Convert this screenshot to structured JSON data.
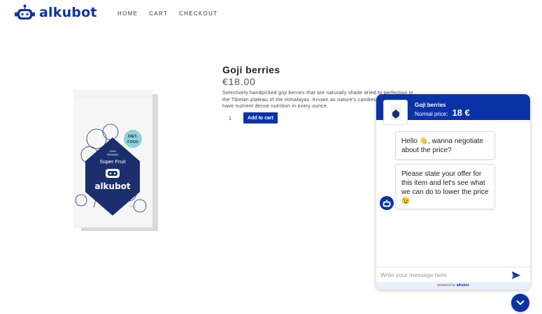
{
  "brand": {
    "name": "alkubot",
    "color": "#0a33a8"
  },
  "nav": {
    "items": [
      "HOME",
      "CART",
      "CHECKOUT"
    ]
  },
  "product": {
    "title": "Goji berries",
    "price": "€18.00",
    "description": "Selectively handpicked goji berries that are naturally shade dried to perfection in the Tibetan plateau of the Himalayas. Known as nature's candies our goji berries have nutrient dense nutrition in every ounce.",
    "quantity": "1",
    "add_to_cart_label": "Add to cart",
    "package": {
      "badge": [
        "DIET-",
        "FOOD"
      ],
      "organic": [
        "100%",
        "ORGANIC"
      ],
      "label": "Super Fruit",
      "brand": "alkubot",
      "weight": "500 g"
    }
  },
  "chat": {
    "product_title": "Goji berries",
    "normal_price_label": "Normal price:",
    "normal_price_value": "18 €",
    "messages": [
      {
        "from": "bot",
        "text": "Hello 👋, wanna negotiate about the price?"
      },
      {
        "from": "bot",
        "text": "Please state your offer for this item and let's see what we can do to lower the price 😉"
      }
    ],
    "input_placeholder": "Write your message here",
    "powered_by": "powered by",
    "powered_brand": "alkubot"
  },
  "icons": {
    "send": "send-icon",
    "toggle": "chevron-down-icon",
    "bot": "robot-icon"
  }
}
